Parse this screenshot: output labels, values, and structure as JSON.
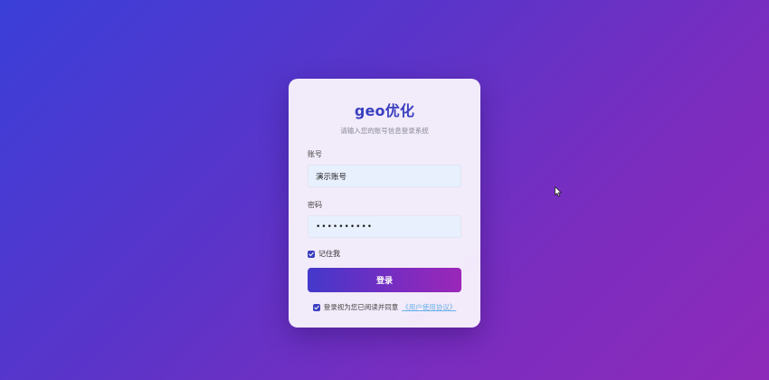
{
  "login": {
    "title": "geo优化",
    "subtitle": "请输入您的账号信息登录系统",
    "account_label": "账号",
    "account_value": "演示账号",
    "password_label": "密码",
    "password_value": "••••••••••",
    "remember_label": "记住我",
    "remember_checked": true,
    "submit_label": "登录",
    "agreement_text": "登录视为您已阅读并同意",
    "agreement_link": "《用户使用协议》",
    "agreement_checked": true
  },
  "colors": {
    "accent": "#3b3fbf",
    "link": "#6ab0e8",
    "input_bg": "#e8f0fe"
  },
  "icons": {
    "remember_checkbox": "check-icon",
    "agreement_checkbox": "check-icon",
    "cursor": "mouse-pointer-icon"
  }
}
